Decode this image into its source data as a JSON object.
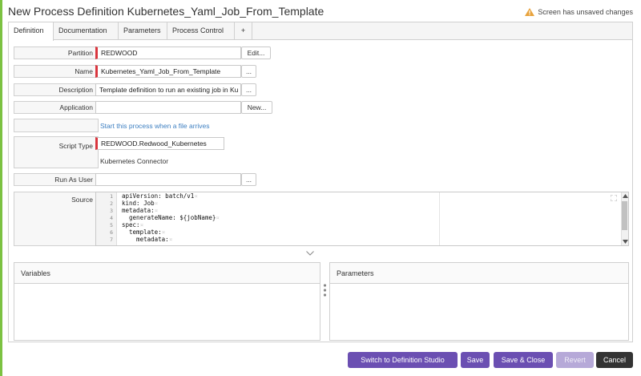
{
  "header": {
    "title": "New Process Definition Kubernetes_Yaml_Job_From_Template",
    "unsaved_notice": "Screen has unsaved changes",
    "warning_color": "#e8a33d"
  },
  "tabs": [
    {
      "label": "Definition",
      "active": true
    },
    {
      "label": "Documentation",
      "active": false
    },
    {
      "label": "Parameters",
      "active": false
    },
    {
      "label": "Process Control",
      "active": false
    },
    {
      "label": "+",
      "active": false
    }
  ],
  "form": {
    "partition": {
      "label": "Partition",
      "value": "REDWOOD",
      "button": "Edit..."
    },
    "name": {
      "label": "Name",
      "value": "Kubernetes_Yaml_Job_From_Template",
      "button": "..."
    },
    "description": {
      "label": "Description",
      "value": "Template definition to run an existing job in Ku",
      "button": "..."
    },
    "application": {
      "label": "Application",
      "value": "",
      "button": "New..."
    },
    "file_event_link": "Start this process when a file arrives",
    "script_type": {
      "label": "Script Type",
      "value": "REDWOOD.Redwood_Kubernetes",
      "connector": "Kubernetes Connector"
    },
    "run_as_user": {
      "label": "Run As User",
      "value": "",
      "button": "..."
    },
    "source": {
      "label": "Source",
      "lines": [
        {
          "n": "1",
          "text": "apiVersion: batch/v1"
        },
        {
          "n": "2",
          "text": "kind: Job"
        },
        {
          "n": "3",
          "text": "metadata:"
        },
        {
          "n": "4",
          "text": "  generateName: ${jobName}"
        },
        {
          "n": "5",
          "text": "spec:"
        },
        {
          "n": "6",
          "text": "  template:"
        },
        {
          "n": "7",
          "text": "    metadata:"
        }
      ]
    }
  },
  "panes": {
    "variables": "Variables",
    "parameters": "Parameters"
  },
  "footer": {
    "switch_studio": "Switch to Definition Studio",
    "save": "Save",
    "save_close": "Save & Close",
    "revert": "Revert",
    "cancel": "Cancel"
  },
  "colors": {
    "accent": "#6b4fb2",
    "required": "#d9363e",
    "link": "#3d7fc1",
    "side_accent": "#7cc242"
  }
}
